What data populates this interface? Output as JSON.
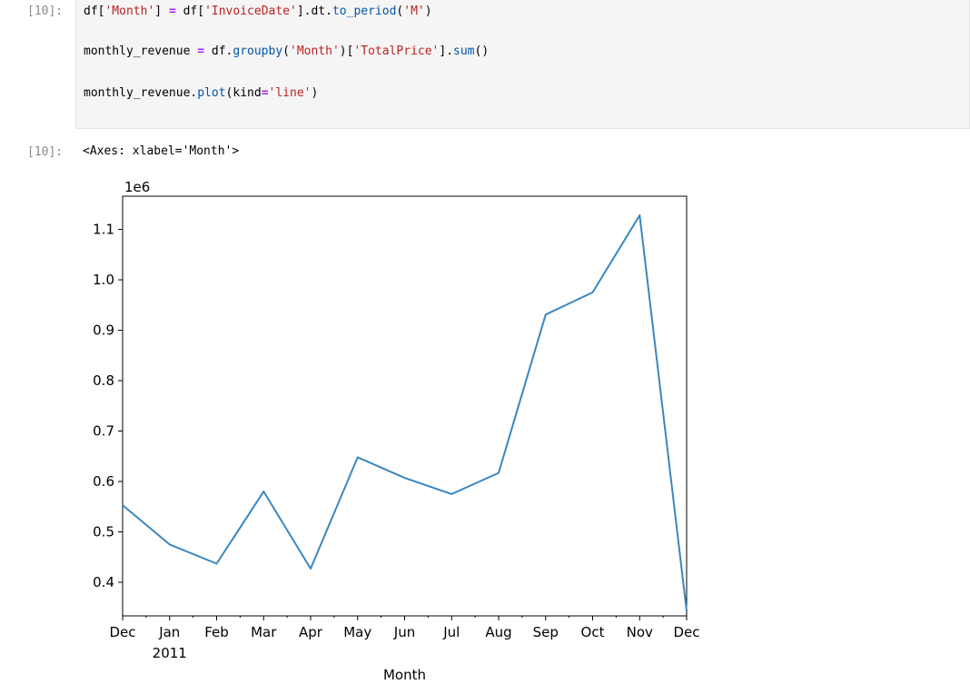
{
  "input_cell": {
    "prompt": "[10]:",
    "lines": [
      [
        {
          "t": "df[",
          "c": "plain"
        },
        {
          "t": "'Month'",
          "c": "str"
        },
        {
          "t": "] ",
          "c": "plain"
        },
        {
          "t": "=",
          "c": "op"
        },
        {
          "t": " df[",
          "c": "plain"
        },
        {
          "t": "'InvoiceDate'",
          "c": "str"
        },
        {
          "t": "].dt.",
          "c": "plain"
        },
        {
          "t": "to_period",
          "c": "fn"
        },
        {
          "t": "(",
          "c": "plain"
        },
        {
          "t": "'M'",
          "c": "str"
        },
        {
          "t": ")",
          "c": "plain"
        }
      ],
      [
        {
          "t": "monthly_revenue ",
          "c": "plain"
        },
        {
          "t": "=",
          "c": "op"
        },
        {
          "t": " df.",
          "c": "plain"
        },
        {
          "t": "groupby",
          "c": "fn"
        },
        {
          "t": "(",
          "c": "plain"
        },
        {
          "t": "'Month'",
          "c": "str"
        },
        {
          "t": ")[",
          "c": "plain"
        },
        {
          "t": "'TotalPrice'",
          "c": "str"
        },
        {
          "t": "].",
          "c": "plain"
        },
        {
          "t": "sum",
          "c": "fn"
        },
        {
          "t": "()",
          "c": "plain"
        }
      ],
      [
        {
          "t": "monthly_revenue.",
          "c": "plain"
        },
        {
          "t": "plot",
          "c": "fn"
        },
        {
          "t": "(kind",
          "c": "plain"
        },
        {
          "t": "=",
          "c": "op"
        },
        {
          "t": "'line'",
          "c": "str"
        },
        {
          "t": ")",
          "c": "plain"
        }
      ]
    ]
  },
  "output_cell": {
    "prompt": "[10]:",
    "text": "<Axes: xlabel='Month'>"
  },
  "colors": {
    "line": "#3a86c0",
    "prompt": "#8a8a8a",
    "string": "#ba2121",
    "operator": "#aa22ff",
    "function": "#0055aa"
  },
  "chart_data": {
    "type": "line",
    "title": "",
    "xlabel": "Month",
    "ylabel": "",
    "offset_text": "1e6",
    "categories": [
      "Dec",
      "Jan",
      "Feb",
      "Mar",
      "Apr",
      "May",
      "Jun",
      "Jul",
      "Aug",
      "Sep",
      "Oct",
      "Nov",
      "Dec"
    ],
    "category_sublabels": {
      "1": "2011"
    },
    "values": [
      0.553,
      0.475,
      0.437,
      0.58,
      0.427,
      0.648,
      0.607,
      0.575,
      0.617,
      0.931,
      0.975,
      1.128,
      0.343
    ],
    "yticks": [
      0.4,
      0.5,
      0.6,
      0.7,
      0.8,
      0.9,
      1.0,
      1.1
    ],
    "ytick_labels": [
      "0.4",
      "0.5",
      "0.6",
      "0.7",
      "0.8",
      "0.9",
      "1.0",
      "1.1"
    ],
    "ylim": [
      0.3333,
      1.1659
    ],
    "grid": false,
    "legend": "none"
  }
}
